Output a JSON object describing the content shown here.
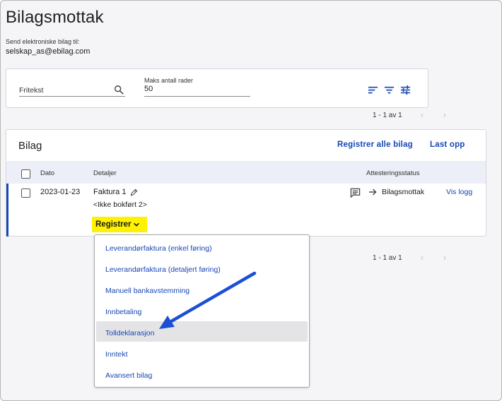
{
  "page": {
    "title": "Bilagsmottak",
    "send_label": "Send elektroniske bilag til:",
    "send_email": "selskap_as@ebilag.com"
  },
  "filter": {
    "fritekst_placeholder": "Fritekst",
    "maks_label": "Maks antall rader",
    "maks_value": "50"
  },
  "pagination_top": {
    "count": "1 - 1 av 1"
  },
  "pagination_bottom": {
    "count": "1 - 1 av 1"
  },
  "bilag": {
    "title": "Bilag",
    "register_all": "Registrer alle bilag",
    "upload": "Last opp",
    "columns": {
      "dato": "Dato",
      "detaljer": "Detaljer",
      "attestering": "Attesteringsstatus"
    },
    "rows": [
      {
        "dato": "2023-01-23",
        "title": "Faktura 1",
        "status_line": "<Ikke bokført 2>",
        "status": "Bilagsmottak",
        "log_link": "Vis logg",
        "register_label": "Registrer"
      }
    ]
  },
  "dropdown": {
    "items": [
      {
        "label": "Leverandørfaktura (enkel føring)"
      },
      {
        "label": "Leverandørfaktura (detaljert føring)"
      },
      {
        "label": "Manuell bankavstemming"
      },
      {
        "label": "Innbetaling"
      },
      {
        "label": "Tolldeklarasjon",
        "highlighted": true
      },
      {
        "label": "Inntekt"
      },
      {
        "label": "Avansert bilag"
      }
    ]
  },
  "colors": {
    "accent": "#1747b5",
    "highlight": "#fff200",
    "annotation_arrow": "#1a4fd6",
    "header_bg": "#eceef8"
  }
}
